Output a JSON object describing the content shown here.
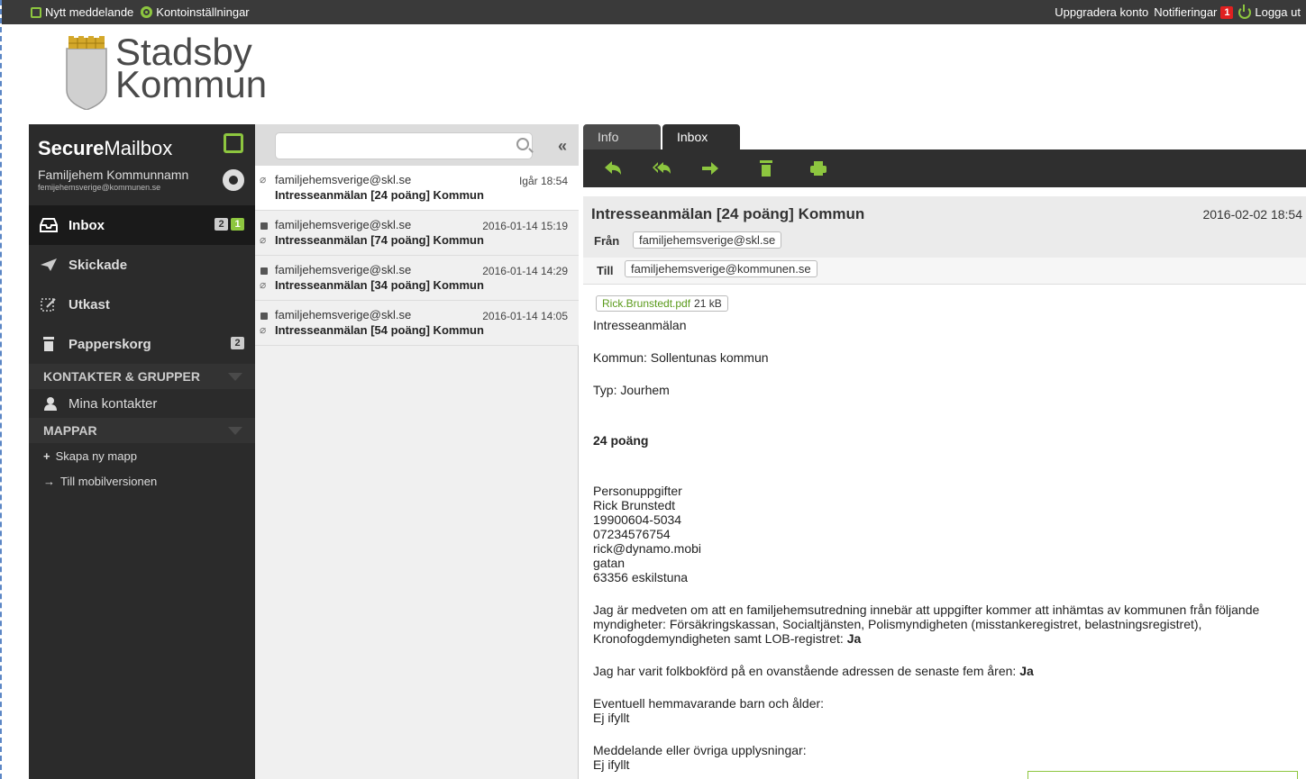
{
  "topbar": {
    "new_message": "Nytt meddelande",
    "account_settings": "Kontoinställningar",
    "upgrade": "Uppgradera konto",
    "notifications": "Notifieringar",
    "notification_count": "1",
    "logout": "Logga ut"
  },
  "logo": {
    "line1": "Stadsby",
    "line2": "Kommun"
  },
  "sidebar": {
    "brand_bold": "Secure",
    "brand_light": "Mailbox",
    "account_name": "Familjehem Kommunnamn",
    "account_email": "femijehemsverige@kommunen.se",
    "inbox_label": "Inbox",
    "inbox_badge_total": "2",
    "inbox_badge_new": "1",
    "sent_label": "Skickade",
    "drafts_label": "Utkast",
    "trash_label": "Papperskorg",
    "trash_badge": "2",
    "contacts_head": "KONTAKTER & GRUPPER",
    "my_contacts": "Mina kontakter",
    "folders_head": "MAPPAR",
    "new_folder": "Skapa ny mapp",
    "mobile": "Till mobilversionen"
  },
  "search": {
    "placeholder": ""
  },
  "messages": [
    {
      "from": "familjehemsverige@skl.se",
      "date": "Igår 18:54",
      "subject": "Intresseanmälan [24 poäng] Kommun"
    },
    {
      "from": "familjehemsverige@skl.se",
      "date": "2016-01-14 15:19",
      "subject": "Intresseanmälan [74 poäng] Kommun"
    },
    {
      "from": "familjehemsverige@skl.se",
      "date": "2016-01-14 14:29",
      "subject": "Intresseanmälan [34 poäng] Kommun"
    },
    {
      "from": "familjehemsverige@skl.se",
      "date": "2016-01-14 14:05",
      "subject": "Intresseanmälan [54 poäng] Kommun"
    }
  ],
  "tabs": {
    "info": "Info",
    "inbox": "Inbox"
  },
  "reader": {
    "subject": "Intresseanmälan [24 poäng] Kommun",
    "date": "2016-02-02 18:54",
    "from_label": "Från",
    "from": "familjehemsverige@skl.se",
    "to_label": "Till",
    "to": "familjehemsverige@kommunen.se",
    "attachment_name": "Rick.Brunstedt.pdf",
    "attachment_size": "21 kB",
    "body": {
      "l1": "Intresseanmälan",
      "l2": "Kommun: Sollentunas kommun",
      "l3": "Typ: Jourhem",
      "l4": "24 poäng",
      "l5": "Personuppgifter",
      "l6": "Rick Brunstedt",
      "l7": "19900604-5034",
      "l8": "07234576754",
      "l9": "rick@dynamo.mobi",
      "l10": "gatan",
      "l11": "63356 eskilstuna",
      "p1": "Jag är medveten om att en familjehemsutredning innebär att uppgifter kommer att inhämtas av kommunen från följande myndigheter: Försäkringskassan, Socialtjänsten, Polismyndigheten (misstankeregistret, belastningsregistret), Kronofogdemyndigheten samt LOB-registret: ",
      "p1_answer": "Ja",
      "p2": "Jag har varit folkbokförd på en ovanstående adressen de senaste fem åren: ",
      "p2_answer": "Ja",
      "q3": "Eventuell hemmavarande barn och ålder:",
      "a3": "Ej ifyllt",
      "q4": "Meddelande eller övriga upplysningar:",
      "a4": "Ej ifyllt"
    }
  },
  "colors": {
    "accent": "#8dc63f",
    "sidebar_bg": "#2b2b2b",
    "topbar_bg": "#3a3a3a"
  }
}
